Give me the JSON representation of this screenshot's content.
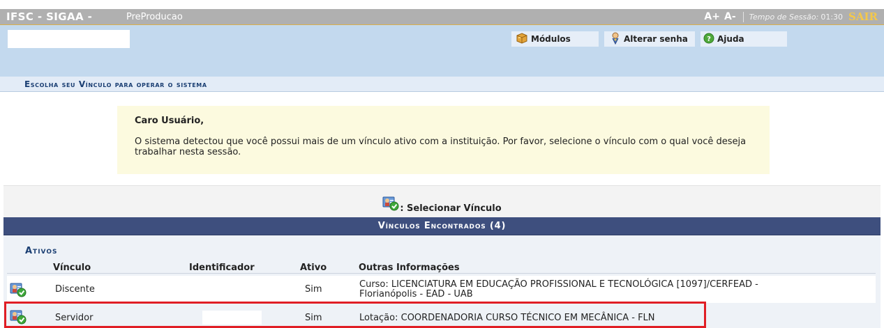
{
  "topbar": {
    "brand": "IFSC - SIGAA -",
    "environment": "PreProducao",
    "font_increase": "A+",
    "font_decrease": "A-",
    "session_label": "Tempo de Sessão:",
    "session_time": "01:30",
    "logout": "SAIR"
  },
  "menu": {
    "modules": "Módulos",
    "change_password": "Alterar senha",
    "help": "Ajuda"
  },
  "section_title": "Escolha seu Vínculo para operar o sistema",
  "notice": {
    "heading": "Caro Usuário,",
    "text": "O sistema detectou que você possui mais de um vínculo ativo com a instituição. Por favor, selecione o vínculo com o qual você deseja trabalhar nesta sessão."
  },
  "legend": {
    "label": ": Selecionar Vínculo"
  },
  "table": {
    "title": "Vínculos Encontrados (4)",
    "group": "Ativos",
    "columns": [
      "Vínculo",
      "Identificador",
      "Ativo",
      "Outras Informações"
    ],
    "rows": [
      {
        "vinculo": "Discente",
        "ativo": "Sim",
        "info_line1": "Curso: LICENCIATURA EM EDUCAÇÃO PROFISSIONAL E TECNOLÓGICA [1097]/CERFEAD -",
        "info_line2": "Florianópolis - EAD - UAB"
      },
      {
        "vinculo": "Servidor",
        "ativo": "Sim",
        "info_line1": "Lotação: COORDENADORIA CURSO TÉCNICO EM MECÂNICA - FLN"
      }
    ]
  },
  "colors": {
    "topbar": "#b0b0b0",
    "menubar": "#c3d9ee",
    "table_header": "#3e4f7e",
    "notice_bg": "#fcfadf",
    "highlight": "#e01e25",
    "logout": "#f4c84a"
  },
  "icons": {
    "modules": "box-icon",
    "change_password": "user-key-icon",
    "help": "help-icon",
    "select": "user-check-icon"
  }
}
